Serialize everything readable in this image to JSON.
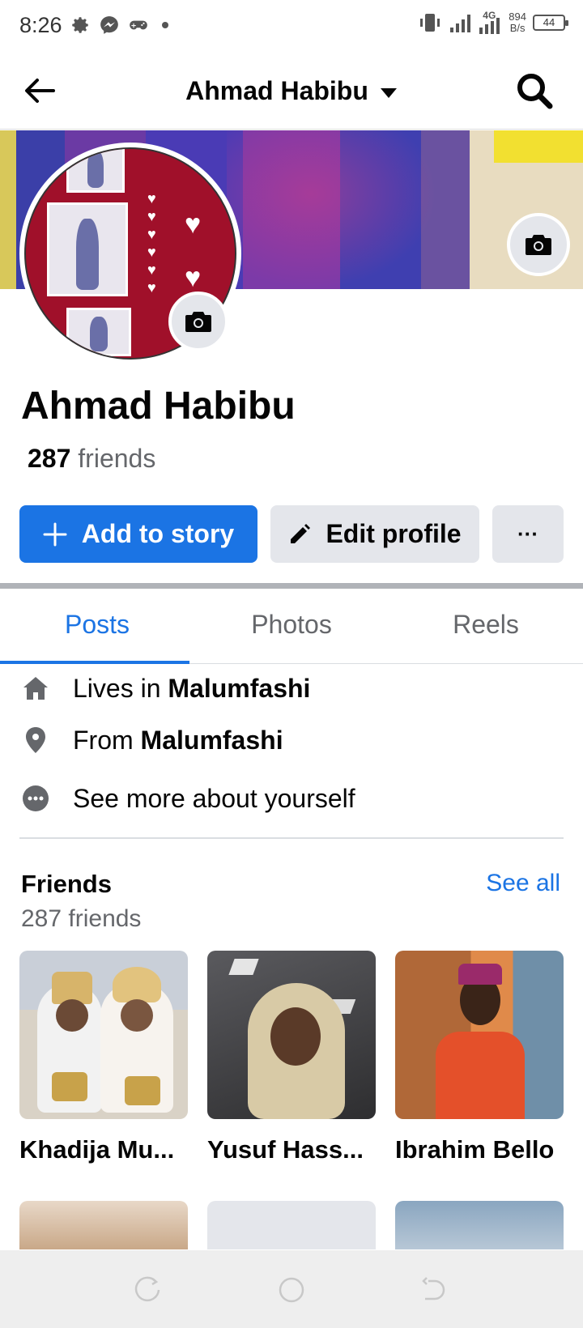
{
  "status_bar": {
    "time": "8:26",
    "net_speed_value": "894",
    "net_speed_unit": "B/s",
    "battery": "44",
    "network_label": "4G"
  },
  "header": {
    "title": "Ahmad Habibu"
  },
  "profile": {
    "name": "Ahmad Habibu",
    "friend_count": "287",
    "friend_word": "friends"
  },
  "actions": {
    "add_story": "Add to story",
    "edit_profile": "Edit profile",
    "more": "···"
  },
  "tabs": [
    {
      "label": "Posts",
      "active": true
    },
    {
      "label": "Photos",
      "active": false
    },
    {
      "label": "Reels",
      "active": false
    }
  ],
  "details": {
    "lives_prefix": "Lives in",
    "lives_place": "Malumfashi",
    "from_prefix": "From",
    "from_place": "Malumfashi",
    "see_more": "See more about yourself"
  },
  "friends": {
    "title": "Friends",
    "see_all": "See all",
    "subtitle": "287 friends",
    "list": [
      {
        "name": "Khadija Mu..."
      },
      {
        "name": "Yusuf Hass..."
      },
      {
        "name": "Ibrahim Bello"
      }
    ]
  },
  "colors": {
    "accent": "#1b74e4",
    "button_gray": "#e4e6eb",
    "secondary_text": "#65676b"
  }
}
